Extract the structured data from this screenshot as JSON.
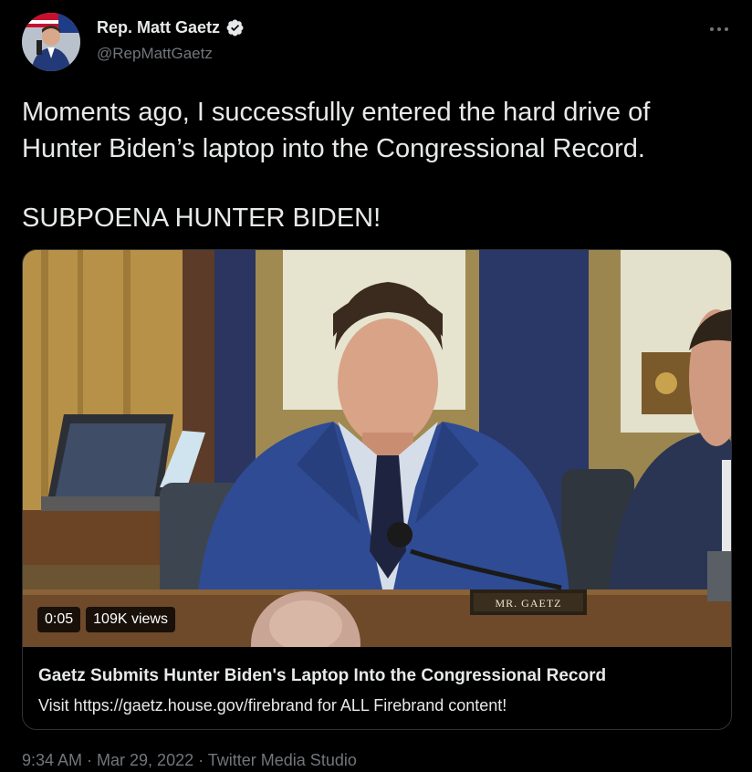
{
  "author": {
    "name": "Rep. Matt Gaetz",
    "handle": "@RepMattGaetz",
    "verified_icon": "verified-badge-icon",
    "more_icon": "more-options-icon"
  },
  "tweet": {
    "line1": "Moments ago, I successfully entered the hard drive of",
    "line2": "Hunter Biden’s laptop into the Congressional Record.",
    "line3": "SUBPOENA HUNTER BIDEN!"
  },
  "media": {
    "duration": "0:05",
    "views": "109K views",
    "nameplate": "MR. GAETZ",
    "title": "Gaetz Submits Hunter Biden's Laptop Into the Congressional Record",
    "description": "Visit https://gaetz.house.gov/firebrand for ALL Firebrand content!"
  },
  "meta": {
    "timestamp": "9:34 AM · Mar 29, 2022 · Twitter Media Studio"
  },
  "colors": {
    "background": "#000000",
    "text": "#e7e9ea",
    "secondary_text": "#71767b",
    "verified": "#e7e9ea",
    "suit_blue": "#2f4b93"
  }
}
